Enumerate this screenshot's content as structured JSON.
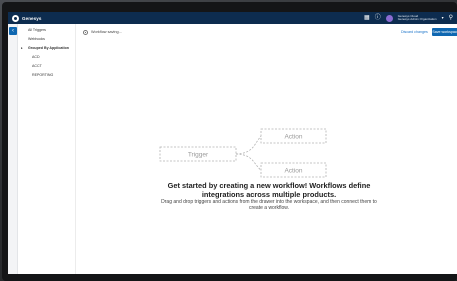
{
  "app": {
    "name": "Genesys"
  },
  "topbar": {
    "icons": [
      "grid-icon",
      "help-icon",
      "avatar",
      "chevron-down-icon",
      "search-icon"
    ],
    "user_line1": "Genesys Cloud",
    "user_line2": "Genesys Admin Organization"
  },
  "tree": {
    "items": [
      {
        "label": "All Triggers"
      },
      {
        "label": "Webhooks"
      },
      {
        "label": "Grouped By Application"
      },
      {
        "label": "ACD"
      },
      {
        "label": "ACCT"
      },
      {
        "label": "REPORTING"
      }
    ]
  },
  "workspace": {
    "status": "Workflow saving...",
    "discard_label": "Discard changes",
    "save_label": "Save workspace"
  },
  "diagram": {
    "trigger_label": "Trigger",
    "action_top": "Action",
    "action_bottom": "Action"
  },
  "empty_state": {
    "title": "Get started by creating a new workflow! Workflows define integrations across multiple products.",
    "subtitle": "Drag and drop triggers and actions from the drawer into the workspace, and then connect them to create a workflow."
  }
}
